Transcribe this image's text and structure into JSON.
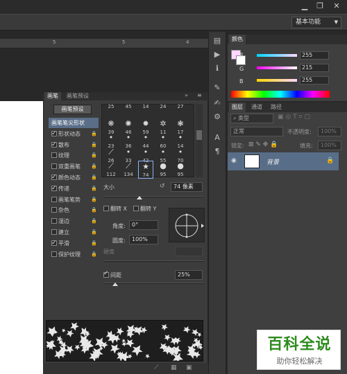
{
  "window": {
    "minimize": "▁",
    "restore": "❐",
    "close": "✕"
  },
  "workspace": {
    "label": "基本功能"
  },
  "ruler": {
    "ticks": [
      "5",
      "5",
      "4"
    ]
  },
  "color_panel": {
    "tabs": [
      "颜色"
    ],
    "sliders": [
      {
        "label": "R",
        "value": "255"
      },
      {
        "label": "G",
        "value": "215"
      },
      {
        "label": "B",
        "value": "255"
      }
    ],
    "foreground": "#ffd7ff",
    "spectrum_label": ""
  },
  "layers_panel": {
    "tabs": [
      "图层",
      "通道",
      "路径"
    ],
    "kind_filter": "类型",
    "blend_mode": "正常",
    "opacity_label": "不透明度:",
    "opacity_value": "100%",
    "lock_label": "锁定:",
    "fill_label": "填充:",
    "fill_value": "100%",
    "layer": {
      "name": "背景"
    }
  },
  "brush_panel": {
    "tabs": [
      "画笔",
      "画笔预设"
    ],
    "preset_button": "画笔预设",
    "options": [
      {
        "label": "画笔笔尖形状",
        "checked": false,
        "selected": true,
        "checkbox": false
      },
      {
        "label": "形状动态",
        "checked": true,
        "selected": false,
        "checkbox": true
      },
      {
        "label": "散布",
        "checked": true,
        "selected": false,
        "checkbox": true
      },
      {
        "label": "纹理",
        "checked": false,
        "selected": false,
        "checkbox": true
      },
      {
        "label": "双重画笔",
        "checked": false,
        "selected": false,
        "checkbox": true
      },
      {
        "label": "颜色动态",
        "checked": true,
        "selected": false,
        "checkbox": true
      },
      {
        "label": "传递",
        "checked": true,
        "selected": false,
        "checkbox": true
      },
      {
        "label": "画笔笔势",
        "checked": false,
        "selected": false,
        "checkbox": true
      },
      {
        "label": "杂色",
        "checked": false,
        "selected": false,
        "checkbox": true
      },
      {
        "label": "湿边",
        "checked": false,
        "selected": false,
        "checkbox": true
      },
      {
        "label": "建立",
        "checked": false,
        "selected": false,
        "checkbox": true
      },
      {
        "label": "平滑",
        "checked": true,
        "selected": false,
        "checkbox": true
      },
      {
        "label": "保护纹理",
        "checked": false,
        "selected": false,
        "checkbox": true
      }
    ],
    "tips": [
      [
        "25",
        "45",
        "14",
        "24",
        "27"
      ],
      [
        "39",
        "46",
        "59",
        "11",
        "17"
      ],
      [
        "23",
        "36",
        "44",
        "60",
        "14"
      ],
      [
        "26",
        "33",
        "42",
        "55",
        "70"
      ],
      [
        "112",
        "134",
        "74",
        "95",
        "95"
      ]
    ],
    "size_label": "大小",
    "size_value": "74 像素",
    "flip_x": "翻转 X",
    "flip_y": "翻转 Y",
    "angle_label": "角度:",
    "angle_value": "0°",
    "roundness_label": "圆度:",
    "roundness_value": "100%",
    "hardness_label": "硬度",
    "spacing_label": "间距",
    "spacing_value": "25%"
  },
  "watermark": {
    "title": "百科全说",
    "subtitle": "助你轻松解决"
  }
}
